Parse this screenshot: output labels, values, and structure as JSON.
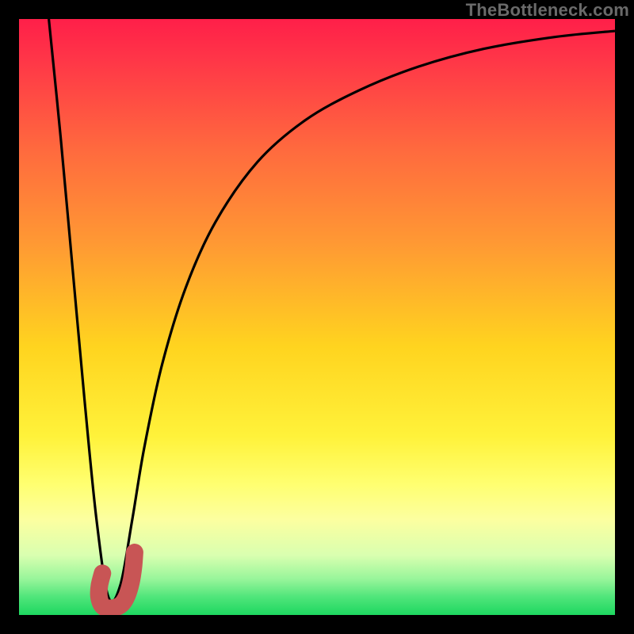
{
  "watermark": "TheBottleneck.com",
  "chart_data": {
    "type": "line",
    "title": "",
    "xlabel": "",
    "ylabel": "",
    "xlim": [
      0,
      100
    ],
    "ylim": [
      0,
      100
    ],
    "series": [
      {
        "name": "bottleneck-curve",
        "x": [
          5,
          7,
          9,
          11,
          13,
          15,
          17,
          19,
          21,
          24,
          28,
          33,
          40,
          48,
          57,
          67,
          78,
          90,
          100
        ],
        "y": [
          100,
          80,
          58,
          36,
          16,
          3,
          5,
          16,
          28,
          42,
          55,
          66,
          76,
          83,
          88,
          92,
          95,
          97,
          98
        ]
      },
      {
        "name": "highlight-marker",
        "x": [
          14.0,
          13.5,
          13.4,
          13.8,
          14.5,
          16.0,
          17.2,
          18.1,
          18.8,
          19.2,
          19.4
        ],
        "y": [
          7.0,
          5.0,
          3.2,
          1.8,
          1.2,
          1.2,
          1.8,
          3.2,
          5.5,
          8.0,
          10.5
        ]
      }
    ],
    "gradient_stops": [
      {
        "pos": 0,
        "color": "#ff1f49"
      },
      {
        "pos": 55,
        "color": "#ffd41f"
      },
      {
        "pos": 84,
        "color": "#fcffa0"
      },
      {
        "pos": 100,
        "color": "#1ed760"
      }
    ]
  }
}
